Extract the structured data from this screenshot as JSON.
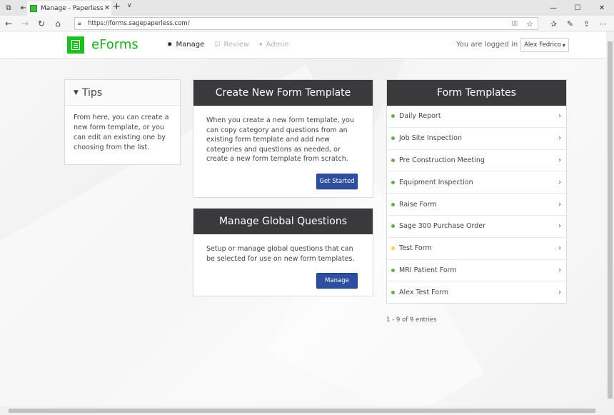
{
  "browser": {
    "tab_title": "Manage - Paperless For",
    "url": "https://forms.sagepaperless.com/"
  },
  "header": {
    "logo_text": "eForms",
    "nav": [
      {
        "label": "Manage",
        "icon": "gear-icon",
        "active": true
      },
      {
        "label": "Review",
        "icon": "checkbox-icon",
        "active": false
      },
      {
        "label": "Admin",
        "icon": "caret-down-icon",
        "active": false
      }
    ],
    "logged_in_text": "You are logged in as",
    "user_name": "Alex Fedrico"
  },
  "tips": {
    "title": "Tips",
    "body": "From here, you can create a new form template, or you can edit an existing one by choosing from the list."
  },
  "create_panel": {
    "title": "Create New Form Template",
    "body": "When you create a new form template, you can copy category and questions from an existing form template and add new categories and questions as needed, or create a new form template from scratch.",
    "button": "Get Started"
  },
  "global_panel": {
    "title": "Manage Global Questions",
    "body": "Setup or manage global questions that can be selected for use on new form templates.",
    "button": "Manage"
  },
  "templates": {
    "title": "Form Templates",
    "items": [
      {
        "label": "Daily Report",
        "status_color": "#6aa84f"
      },
      {
        "label": "Job Site Inspection",
        "status_color": "#6aa84f"
      },
      {
        "label": "Pre Construction Meeting",
        "status_color": "#6aa84f"
      },
      {
        "label": "Equipment Inspection",
        "status_color": "#6aa84f"
      },
      {
        "label": "Raise Form",
        "status_color": "#6aa84f"
      },
      {
        "label": "Sage 300 Purchase Order",
        "status_color": "#6aa84f"
      },
      {
        "label": "Test Form",
        "status_color": "#f1d04b"
      },
      {
        "label": "MRI Patient Form",
        "status_color": "#6aa84f"
      },
      {
        "label": "Alex Test Form",
        "status_color": "#6aa84f"
      }
    ],
    "entries": "1 - 9 of 9 entries"
  }
}
